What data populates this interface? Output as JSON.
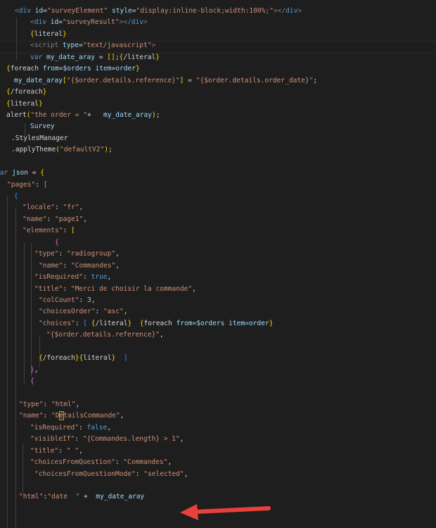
{
  "lines": [
    {
      "tokens": [
        {
          "t": "<",
          "c": "g"
        },
        {
          "t": "div",
          "c": "k"
        },
        {
          "t": " id",
          "c": "a"
        },
        {
          "t": "=",
          "c": "w"
        },
        {
          "t": "\"surveyElement\"",
          "c": "s"
        },
        {
          "t": " style",
          "c": "a"
        },
        {
          "t": "=",
          "c": "w"
        },
        {
          "t": "\"display:inline-block;width:100%;\"",
          "c": "s"
        },
        {
          "t": "></",
          "c": "g"
        },
        {
          "t": "div",
          "c": "k"
        },
        {
          "t": ">",
          "c": "g"
        }
      ]
    },
    {
      "tokens": [
        {
          "t": "<",
          "c": "g"
        },
        {
          "t": "div",
          "c": "k"
        },
        {
          "t": " id",
          "c": "a"
        },
        {
          "t": "=",
          "c": "w"
        },
        {
          "t": "\"surveyResult\"",
          "c": "s"
        },
        {
          "t": "></",
          "c": "g"
        },
        {
          "t": "div",
          "c": "k"
        },
        {
          "t": ">",
          "c": "g"
        }
      ]
    },
    {
      "tokens": [
        {
          "t": "{",
          "c": "y"
        },
        {
          "t": "literal",
          "c": "w"
        },
        {
          "t": "}",
          "c": "y"
        }
      ]
    },
    {
      "tokens": [
        {
          "t": "<script",
          "c": "g"
        },
        {
          "t": " type",
          "c": "a"
        },
        {
          "t": "=",
          "c": "w"
        },
        {
          "t": "\"text/javascript\"",
          "c": "s"
        },
        {
          "t": ">",
          "c": "g"
        }
      ]
    },
    {
      "tokens": [
        {
          "t": "var",
          "c": "k"
        },
        {
          "t": " my_date_aray",
          "c": "a"
        },
        {
          "t": " = ",
          "c": "w"
        },
        {
          "t": "[]",
          "c": "y"
        },
        {
          "t": ";",
          "c": "w"
        },
        {
          "t": "{",
          "c": "y"
        },
        {
          "t": "/literal",
          "c": "w"
        },
        {
          "t": "}",
          "c": "y"
        }
      ]
    },
    {
      "tokens": [
        {
          "t": "{",
          "c": "y"
        },
        {
          "t": "foreach ",
          "c": "w"
        },
        {
          "t": "from",
          "c": "a"
        },
        {
          "t": "=",
          "c": "w"
        },
        {
          "t": "$orders item",
          "c": "a"
        },
        {
          "t": "=",
          "c": "w"
        },
        {
          "t": "order",
          "c": "a"
        },
        {
          "t": "}",
          "c": "y"
        }
      ]
    },
    {
      "tokens": [
        {
          "t": "my_date_aray",
          "c": "a"
        },
        {
          "t": "[",
          "c": "y"
        },
        {
          "t": "\"{$order.details.reference}\"",
          "c": "s"
        },
        {
          "t": "]",
          "c": "y"
        },
        {
          "t": " = ",
          "c": "w"
        },
        {
          "t": "\"{$order.details.order_date}\"",
          "c": "s"
        },
        {
          "t": ";",
          "c": "w"
        }
      ]
    },
    {
      "tokens": [
        {
          "t": "{",
          "c": "y"
        },
        {
          "t": "/foreach",
          "c": "w"
        },
        {
          "t": "}",
          "c": "y"
        }
      ]
    },
    {
      "tokens": [
        {
          "t": "{",
          "c": "y"
        },
        {
          "t": "literal",
          "c": "w"
        },
        {
          "t": "}",
          "c": "y"
        }
      ]
    },
    {
      "tokens": [
        {
          "t": "alert",
          "c": "w"
        },
        {
          "t": "(",
          "c": "y"
        },
        {
          "t": "\"the order = \"",
          "c": "s"
        },
        {
          "t": "+   ",
          "c": "w"
        },
        {
          "t": "my_date_aray",
          "c": "a"
        },
        {
          "t": ")",
          "c": "y"
        },
        {
          "t": ";",
          "c": "w"
        }
      ]
    },
    {
      "tokens": [
        {
          "t": "Survey",
          "c": "a"
        }
      ]
    },
    {
      "tokens": [
        {
          "t": ".StylesManager",
          "c": "w"
        }
      ]
    },
    {
      "tokens": [
        {
          "t": ".applyTheme",
          "c": "w"
        },
        {
          "t": "(",
          "c": "y"
        },
        {
          "t": "\"defaultV2\"",
          "c": "s"
        },
        {
          "t": ")",
          "c": "y"
        },
        {
          "t": ";",
          "c": "w"
        }
      ]
    },
    {
      "tokens": []
    },
    {
      "tokens": [
        {
          "t": "var",
          "c": "k"
        },
        {
          "t": " json",
          "c": "a"
        },
        {
          "t": " = ",
          "c": "w"
        },
        {
          "t": "{",
          "c": "y"
        }
      ]
    },
    {
      "tokens": [
        {
          "t": "\"pages\"",
          "c": "s"
        },
        {
          "t": ": ",
          "c": "w"
        },
        {
          "t": "[",
          "c": "p"
        }
      ]
    },
    {
      "tokens": [
        {
          "t": "{",
          "c": "b"
        }
      ]
    },
    {
      "tokens": [
        {
          "t": "\"locale\"",
          "c": "s"
        },
        {
          "t": ": ",
          "c": "w"
        },
        {
          "t": "\"fr\"",
          "c": "s"
        },
        {
          "t": ",",
          "c": "w"
        }
      ]
    },
    {
      "tokens": [
        {
          "t": "\"name\"",
          "c": "s"
        },
        {
          "t": ": ",
          "c": "w"
        },
        {
          "t": "\"page1\"",
          "c": "s"
        },
        {
          "t": ",",
          "c": "w"
        }
      ]
    },
    {
      "tokens": [
        {
          "t": "\"elements\"",
          "c": "s"
        },
        {
          "t": ": ",
          "c": "w"
        },
        {
          "t": "[",
          "c": "y"
        }
      ]
    },
    {
      "tokens": [
        {
          "t": "{",
          "c": "p"
        }
      ]
    },
    {
      "tokens": [
        {
          "t": "\"type\"",
          "c": "s"
        },
        {
          "t": ": ",
          "c": "w"
        },
        {
          "t": "\"radiogroup\"",
          "c": "s"
        },
        {
          "t": ",",
          "c": "w"
        }
      ]
    },
    {
      "tokens": [
        {
          "t": "\"name\"",
          "c": "s"
        },
        {
          "t": ": ",
          "c": "w"
        },
        {
          "t": "\"Commandes\"",
          "c": "s"
        },
        {
          "t": ",",
          "c": "w"
        }
      ]
    },
    {
      "tokens": [
        {
          "t": "\"isRequired\"",
          "c": "s"
        },
        {
          "t": ": ",
          "c": "w"
        },
        {
          "t": "true",
          "c": "k"
        },
        {
          "t": ",",
          "c": "w"
        }
      ]
    },
    {
      "tokens": [
        {
          "t": "\"title\"",
          "c": "s"
        },
        {
          "t": ": ",
          "c": "w"
        },
        {
          "t": "\"Merci de choisir la commande\"",
          "c": "s"
        },
        {
          "t": ",",
          "c": "w"
        }
      ]
    },
    {
      "tokens": [
        {
          "t": "\"colCount\"",
          "c": "s"
        },
        {
          "t": ": ",
          "c": "w"
        },
        {
          "t": "3",
          "c": "n"
        },
        {
          "t": ",",
          "c": "w"
        }
      ]
    },
    {
      "tokens": [
        {
          "t": "\"choicesOrder\"",
          "c": "s"
        },
        {
          "t": ": ",
          "c": "w"
        },
        {
          "t": "\"asc\"",
          "c": "s"
        },
        {
          "t": ",",
          "c": "w"
        }
      ]
    },
    {
      "tokens": [
        {
          "t": "\"choices\"",
          "c": "s"
        },
        {
          "t": ": ",
          "c": "w"
        },
        {
          "t": "[",
          "c": "b"
        },
        {
          "t": " ",
          "c": "w"
        },
        {
          "t": "{",
          "c": "y"
        },
        {
          "t": "/literal",
          "c": "w"
        },
        {
          "t": "}",
          "c": "y"
        },
        {
          "t": "  ",
          "c": "w"
        },
        {
          "t": "{",
          "c": "y"
        },
        {
          "t": "foreach ",
          "c": "w"
        },
        {
          "t": "from=$orders item=order",
          "c": "a"
        },
        {
          "t": "}",
          "c": "y"
        }
      ]
    },
    {
      "tokens": [
        {
          "t": "\"{$order.details.reference}\"",
          "c": "s"
        },
        {
          "t": ",",
          "c": "w"
        }
      ]
    },
    {
      "tokens": []
    },
    {
      "tokens": [
        {
          "t": "{",
          "c": "y"
        },
        {
          "t": "/foreach",
          "c": "w"
        },
        {
          "t": "}{",
          "c": "y"
        },
        {
          "t": "literal",
          "c": "w"
        },
        {
          "t": "}",
          "c": "y"
        },
        {
          "t": "  ",
          "c": "w"
        },
        {
          "t": "]",
          "c": "b"
        }
      ]
    },
    {
      "tokens": [
        {
          "t": "}",
          "c": "p"
        },
        {
          "t": ",",
          "c": "w"
        }
      ]
    },
    {
      "tokens": [
        {
          "t": "{",
          "c": "p"
        }
      ]
    },
    {
      "tokens": []
    },
    {
      "tokens": [
        {
          "t": "\"type\"",
          "c": "s"
        },
        {
          "t": ": ",
          "c": "w"
        },
        {
          "t": "\"html\"",
          "c": "s"
        },
        {
          "t": ",",
          "c": "w"
        }
      ]
    },
    {
      "tokens": [
        {
          "t": "\"name\"",
          "c": "s"
        },
        {
          "t": ": ",
          "c": "w"
        },
        {
          "t": "\"D",
          "c": "s"
        },
        {
          "t": "é",
          "c": "s box"
        },
        {
          "t": "tailsCommande\"",
          "c": "s"
        },
        {
          "t": ",",
          "c": "w"
        }
      ]
    },
    {
      "tokens": [
        {
          "t": "\"isRequired\"",
          "c": "s"
        },
        {
          "t": ": ",
          "c": "w"
        },
        {
          "t": "false",
          "c": "k"
        },
        {
          "t": ",",
          "c": "w"
        }
      ]
    },
    {
      "tokens": [
        {
          "t": "\"visibleIf\"",
          "c": "s"
        },
        {
          "t": ": ",
          "c": "w"
        },
        {
          "t": "\"{Commandes.length} > 1\"",
          "c": "s"
        },
        {
          "t": ",",
          "c": "w"
        }
      ]
    },
    {
      "tokens": [
        {
          "t": "\"title\"",
          "c": "s"
        },
        {
          "t": ": ",
          "c": "w"
        },
        {
          "t": "\" \"",
          "c": "s"
        },
        {
          "t": ",",
          "c": "w"
        }
      ]
    },
    {
      "tokens": [
        {
          "t": "\"choicesFromQuestion\"",
          "c": "s"
        },
        {
          "t": ": ",
          "c": "w"
        },
        {
          "t": "\"Commandes\"",
          "c": "s"
        },
        {
          "t": ",",
          "c": "w"
        }
      ]
    },
    {
      "tokens": [
        {
          "t": "\"choicesFromQuestionMode\"",
          "c": "s"
        },
        {
          "t": ": ",
          "c": "w"
        },
        {
          "t": "\"selected\"",
          "c": "s"
        },
        {
          "t": ",",
          "c": "w"
        }
      ]
    },
    {
      "tokens": []
    },
    {
      "tokens": [
        {
          "t": "\"html\"",
          "c": "s"
        },
        {
          "t": ":",
          "c": "w"
        },
        {
          "t": "\"date  \"",
          "c": "s"
        },
        {
          "t": " + ",
          "c": "w"
        },
        {
          "t": " my_date_aray",
          "c": "a"
        }
      ]
    }
  ],
  "colors": {
    "background": "#1e1e1e",
    "arrow": "#e8413c"
  }
}
